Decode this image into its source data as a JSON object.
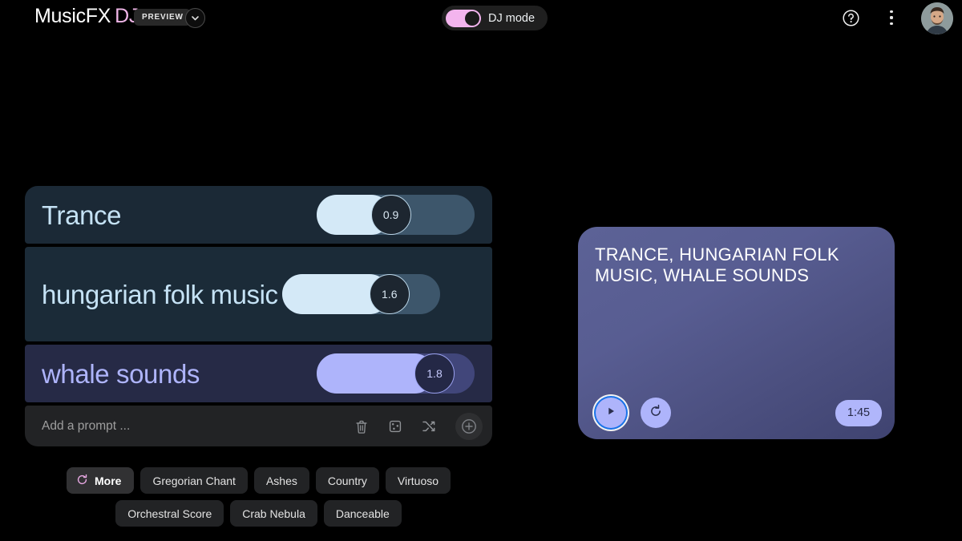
{
  "header": {
    "brand_main": "MusicFX",
    "brand_accent": "DJ",
    "preview_badge": "PREVIEW",
    "dropdown_icon": "chevron-down-icon",
    "dj_mode_label": "DJ mode",
    "dj_mode_on": true,
    "help_icon": "help-circle-icon",
    "overflow_icon": "more-vertical-icon",
    "avatar_icon": "user-avatar"
  },
  "prompts": [
    {
      "label": "Trance",
      "value": "0.9",
      "fill_pct": 46,
      "theme": "blue"
    },
    {
      "label": "hungarian folk music",
      "value": "1.6",
      "fill_pct": 74,
      "theme": "blue"
    },
    {
      "label": "whale sounds",
      "value": "1.8",
      "fill_pct": 83,
      "theme": "purple"
    }
  ],
  "prompt_bar": {
    "placeholder": "Add a prompt ...",
    "value": "",
    "trash_icon": "trash-icon",
    "dice_icon": "dice-icon",
    "shuffle_icon": "shuffle-icon",
    "add_icon": "add-circle-icon"
  },
  "chips": [
    {
      "label": "More",
      "icon": "refresh-icon",
      "primary": true
    },
    {
      "label": "Gregorian Chant",
      "primary": false
    },
    {
      "label": "Ashes",
      "primary": false
    },
    {
      "label": "Country",
      "primary": false
    },
    {
      "label": "Virtuoso",
      "primary": false
    },
    {
      "label": "Orchestral Score",
      "primary": false
    },
    {
      "label": "Crab Nebula",
      "primary": false
    },
    {
      "label": "Danceable",
      "primary": false
    }
  ],
  "player": {
    "title": "TRANCE, HUNGARIAN FOLK MUSIC, WHALE SOUNDS",
    "play_icon": "play-icon",
    "reset_icon": "restart-icon",
    "time": "1:45"
  },
  "colors": {
    "page_bg": "#000000",
    "accent_pink": "#f0b6e8",
    "accent_blue": "#c5e2f5",
    "accent_purple": "#aeb4fb",
    "focus_ring": "#1a73e8"
  }
}
